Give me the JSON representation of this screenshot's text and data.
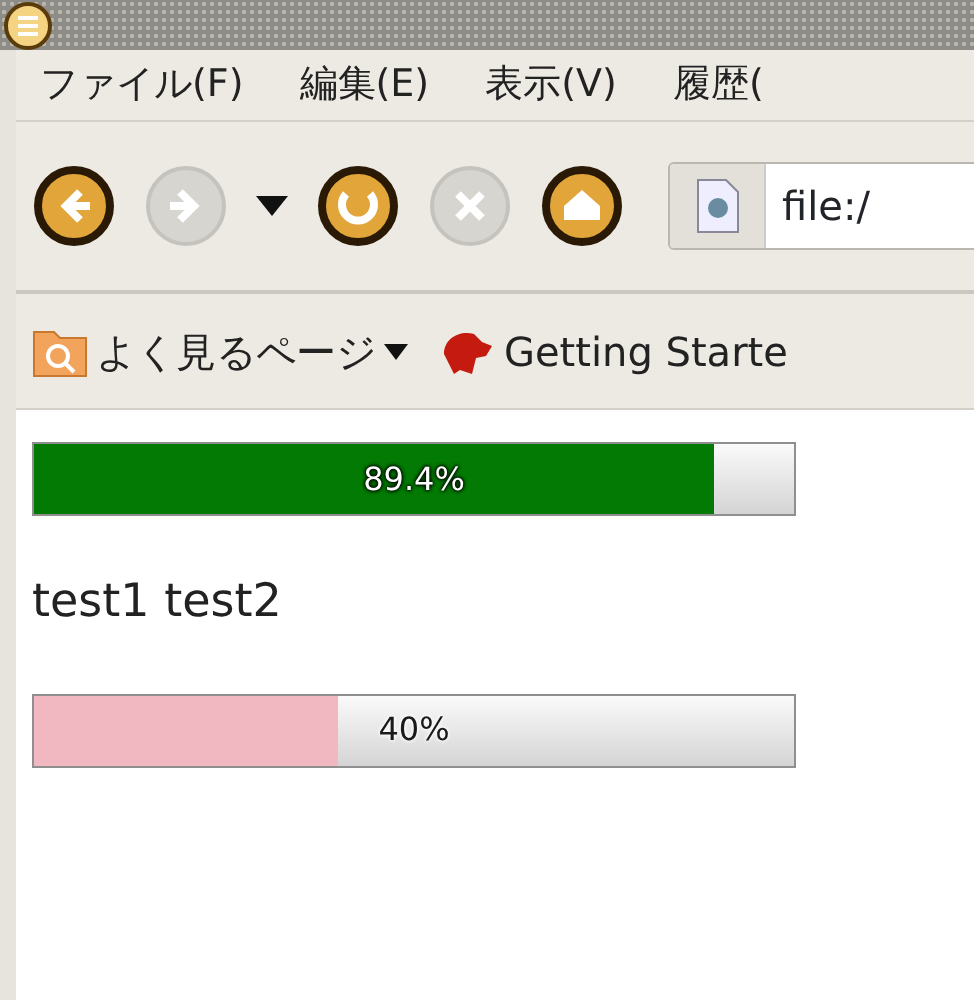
{
  "menu": [
    {
      "label": "ファイル(F)"
    },
    {
      "label": "編集(E)"
    },
    {
      "label": "表示(V)"
    },
    {
      "label": "履歴("
    }
  ],
  "toolbar": {
    "buttons": [
      {
        "kind": "back",
        "disabled": false
      },
      {
        "kind": "forward",
        "disabled": true
      },
      {
        "kind": "dropdown",
        "disabled": false
      },
      {
        "kind": "reload",
        "disabled": false
      },
      {
        "kind": "stop",
        "disabled": true
      },
      {
        "kind": "home",
        "disabled": false
      }
    ],
    "address": "file:/"
  },
  "bookmarks": [
    {
      "kind": "folder",
      "label": "よく見るページ"
    },
    {
      "kind": "page",
      "label": "Getting Starte"
    }
  ],
  "content": {
    "progress_bars": [
      {
        "label": "89.4%",
        "level": 0.894,
        "color": "#037a03"
      },
      {
        "label": "40%",
        "level": 0.4,
        "color": "#f2b8c2"
      }
    ],
    "text": "test1 test2"
  }
}
